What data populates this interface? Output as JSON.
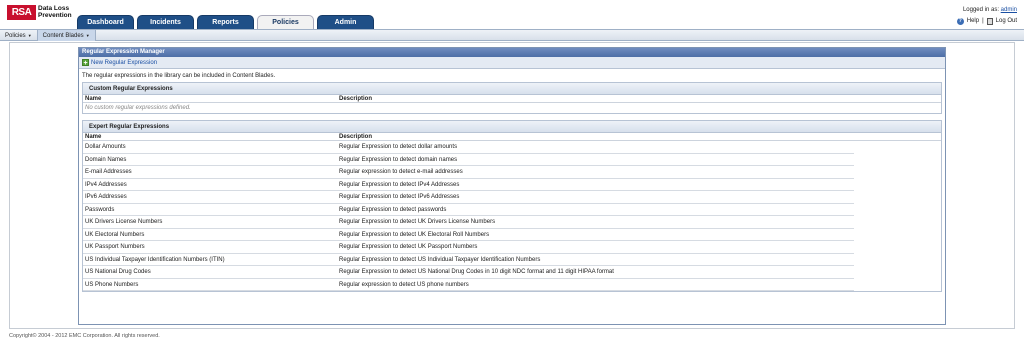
{
  "app": {
    "logo": "RSA",
    "product_line1": "Data Loss",
    "product_line2": "Prevention"
  },
  "tabs": [
    {
      "label": "Dashboard",
      "active": false
    },
    {
      "label": "Incidents",
      "active": false
    },
    {
      "label": "Reports",
      "active": false
    },
    {
      "label": "Policies",
      "active": true
    },
    {
      "label": "Admin",
      "active": false
    }
  ],
  "user": {
    "logged_in_label": "Logged in as:",
    "username": "admin",
    "help": "Help",
    "separator": "|",
    "logout": "Log Out"
  },
  "subnav": {
    "policies": "Policies",
    "content_blades": "Content Blades"
  },
  "panel": {
    "title": "Regular Expression Manager",
    "new_button": "New Regular Expression",
    "intro": "The regular expressions in the library can be included in Content Blades."
  },
  "custom": {
    "title": "Custom Regular Expressions",
    "col_name": "Name",
    "col_desc": "Description",
    "empty": "No custom regular expressions defined."
  },
  "expert": {
    "title": "Expert Regular Expressions",
    "col_name": "Name",
    "col_desc": "Description",
    "rows": [
      {
        "name": "Dollar Amounts",
        "desc": "Regular Expression to detect dollar amounts"
      },
      {
        "name": "Domain Names",
        "desc": "Regular Expression to detect domain names"
      },
      {
        "name": "E-mail Addresses",
        "desc": "Regular expression to detect e-mail addresses"
      },
      {
        "name": "IPv4 Addresses",
        "desc": "Regular Expression to detect IPv4 Addresses"
      },
      {
        "name": "IPv6 Addresses",
        "desc": "Regular Expression to detect IPv6 Addresses"
      },
      {
        "name": "Passwords",
        "desc": "Regular Expression to detect passwords"
      },
      {
        "name": "UK Drivers License Numbers",
        "desc": "Regular Expression to detect UK Drivers License Numbers"
      },
      {
        "name": "UK Electoral Numbers",
        "desc": "Regular Expression to detect UK Electoral Roll Numbers"
      },
      {
        "name": "UK Passport Numbers",
        "desc": "Regular Expression to detect UK Passport Numbers"
      },
      {
        "name": "US Individual Taxpayer Identification Numbers (ITIN)",
        "desc": "Regular Expression to detect US Individual Taxpayer Identification Numbers"
      },
      {
        "name": "US National Drug Codes",
        "desc": "Regular Expression to detect US National Drug Codes in 10 digit NDC format and 11 digit HIPAA format"
      },
      {
        "name": "US Phone Numbers",
        "desc": "Regular expression to detect US phone numbers"
      }
    ]
  },
  "footer": "Copyright© 2004 - 2012  EMC Corporation. All rights reserved."
}
